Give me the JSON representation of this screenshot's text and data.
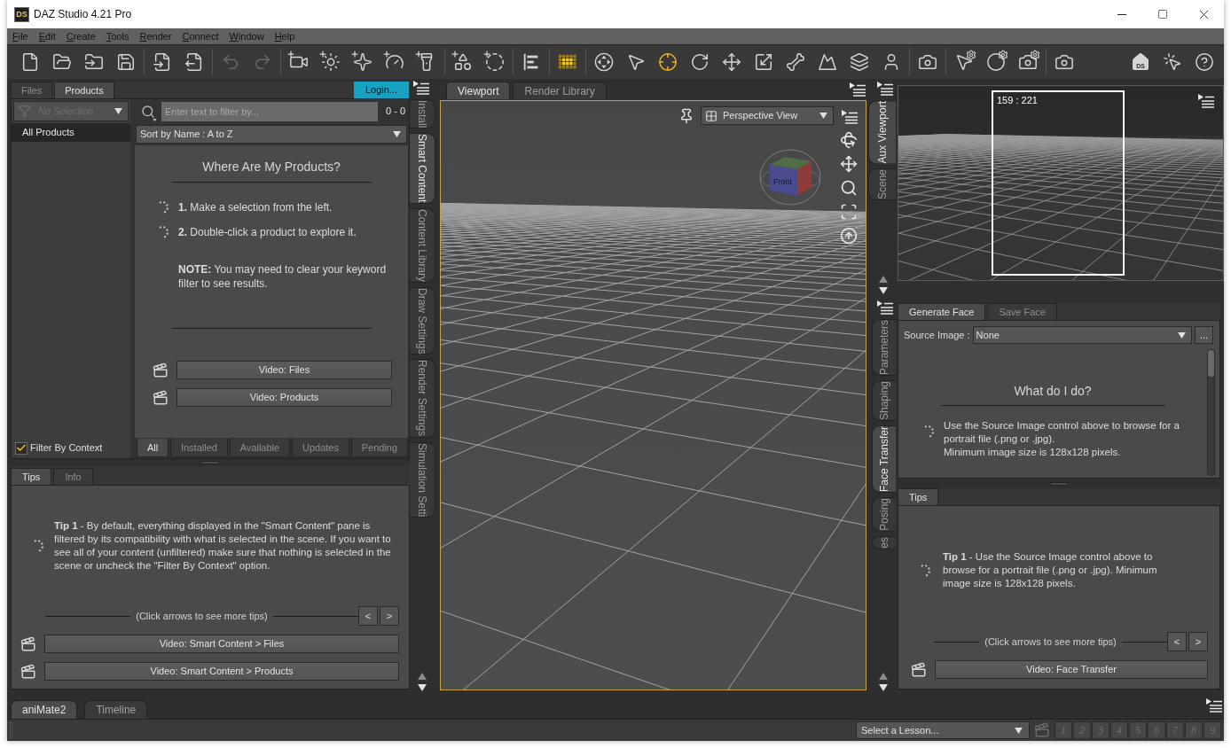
{
  "window": {
    "logo": "DS",
    "title": "DAZ Studio 4.21 Pro"
  },
  "menu": [
    "File",
    "Edit",
    "Create",
    "Tools",
    "Render",
    "Connect",
    "Window",
    "Help"
  ],
  "toolbar": {
    "groups": [
      {
        "items": [
          {
            "kind": "new",
            "disabled": false
          },
          {
            "kind": "open",
            "disabled": false
          },
          {
            "kind": "merge",
            "disabled": false
          },
          {
            "kind": "save",
            "disabled": false
          }
        ]
      },
      {
        "items": [
          {
            "kind": "import",
            "disabled": false
          },
          {
            "kind": "export",
            "disabled": false
          }
        ]
      },
      {
        "items": [
          {
            "kind": "undo",
            "disabled": true
          },
          {
            "kind": "redo",
            "disabled": true
          }
        ]
      },
      {
        "items": [
          {
            "kind": "camera",
            "disabled": false
          },
          {
            "kind": "distant_light",
            "disabled": false
          },
          {
            "kind": "point_light",
            "disabled": false
          },
          {
            "kind": "dial",
            "disabled": false
          },
          {
            "kind": "spotlight",
            "disabled": false
          }
        ]
      },
      {
        "items": [
          {
            "kind": "primitive",
            "disabled": false
          },
          {
            "kind": "null",
            "disabled": false
          }
        ]
      },
      {
        "items": [
          {
            "kind": "align",
            "disabled": false
          }
        ]
      },
      {
        "items": [
          {
            "kind": "pixel_grid",
            "disabled": false
          }
        ]
      },
      {
        "items": [
          {
            "kind": "navigate",
            "selected": false
          },
          {
            "kind": "select",
            "selected": false
          },
          {
            "kind": "universal",
            "selected": true
          },
          {
            "kind": "rotate",
            "selected": false
          },
          {
            "kind": "translate",
            "selected": false
          },
          {
            "kind": "scale",
            "selected": false
          },
          {
            "kind": "joint",
            "selected": false
          },
          {
            "kind": "geometry",
            "selected": false
          },
          {
            "kind": "surface",
            "selected": false
          },
          {
            "kind": "weight",
            "selected": false
          }
        ]
      },
      {
        "items": [
          {
            "kind": "camera_pointer",
            "disabled": false
          }
        ]
      },
      {
        "items": [
          {
            "kind": "pointer_gear",
            "disabled": false
          },
          {
            "kind": "sphere_gear",
            "disabled": false
          },
          {
            "kind": "camera_gear",
            "disabled": false
          }
        ]
      },
      {
        "items": [
          {
            "kind": "snapshot",
            "disabled": false
          }
        ]
      }
    ],
    "right": [
      {
        "kind": "home",
        "label": "DS"
      },
      {
        "kind": "whats_this"
      },
      {
        "kind": "help"
      }
    ]
  },
  "content_pane": {
    "tabs": [
      {
        "label": "Files",
        "selected": false
      },
      {
        "label": "Products",
        "selected": true
      }
    ],
    "login_button": "Login...",
    "category_dropdown": {
      "value": "No Selection",
      "disabled": true
    },
    "categories": [
      {
        "label": "All Products",
        "selected": true
      }
    ],
    "filter_by_context": {
      "label": "Filter By Context",
      "checked": true
    },
    "search": {
      "placeholder": "Enter text to filter by...",
      "count": "0 - 0"
    },
    "sort_dropdown": "Sort by Name : A to Z",
    "help_title": "Where Are My Products?",
    "steps": [
      "**1.** Make a selection from the left.",
      "**2.** Double-click a product to explore it."
    ],
    "note": "**NOTE:** You may need to clear your keyword filter to see results.",
    "video_buttons": [
      "Video: Files",
      "Video: Products"
    ],
    "status_tabs": [
      {
        "label": "All",
        "selected": true
      },
      {
        "label": "Installed",
        "selected": false
      },
      {
        "label": "Available",
        "selected": false
      },
      {
        "label": "Updates",
        "selected": false
      },
      {
        "label": "Pending",
        "selected": false
      }
    ]
  },
  "left_side_tabs": [
    {
      "label": "Install",
      "selected": false
    },
    {
      "label": "Smart Content",
      "selected": true
    },
    {
      "label": "Content Library",
      "selected": false
    },
    {
      "label": "Draw Settings",
      "selected": false
    },
    {
      "label": "Render Settings",
      "selected": false
    },
    {
      "label": "Simulation Setti",
      "selected": false
    }
  ],
  "tips_pane": {
    "tabs": [
      {
        "label": "Tips",
        "selected": true
      },
      {
        "label": "Info",
        "selected": false
      }
    ],
    "tip": "**Tip 1** - By default, everything displayed in the \"Smart Content\" pane is filtered by its compatibility with what is selected in the scene. If you want to see all of your content (unfiltered) make sure that nothing is selected in the scene or uncheck the \"Filter By Context\" option.",
    "hint": "(Click arrows to see more tips)",
    "prev_button": "<",
    "next_button": ">",
    "video_buttons": [
      "Video: Smart Content > Files",
      "Video: Smart Content > Products"
    ]
  },
  "viewport_pane": {
    "tabs": [
      {
        "label": "Viewport",
        "selected": true
      },
      {
        "label": "Render Library",
        "selected": false
      }
    ],
    "camera_dropdown": "Perspective View",
    "cube_label": "Front"
  },
  "aux_side_tabs": [
    {
      "label": "Aux Viewport",
      "selected": true
    },
    {
      "label": "Scene",
      "selected": false
    }
  ],
  "aux_viewport": {
    "frame_size": "159 : 221"
  },
  "right_side_tabs": [
    {
      "label": "Parameters",
      "selected": false
    },
    {
      "label": "Shaping",
      "selected": false
    },
    {
      "label": "Face Transfer",
      "selected": true
    },
    {
      "label": "Posing",
      "selected": false
    },
    {
      "label": "es",
      "selected": false
    }
  ],
  "face_transfer": {
    "tabs": [
      {
        "label": "Generate Face",
        "selected": true
      },
      {
        "label": "Save Face",
        "selected": false
      }
    ],
    "source_label": "Source Image :",
    "source_value": "None",
    "browse_button": "...",
    "title": "What do I do?",
    "instructions": "Use the Source Image control above to browse for a portrait file (.png or .jpg).\nMinimum image size is 128x128 pixels."
  },
  "face_tips": {
    "tabs": [
      {
        "label": "Tips",
        "selected": true
      }
    ],
    "tip": "**Tip 1** - Use the Source Image control above to browse for a portrait file (.png or .jpg). Minimum image size is 128x128 pixels.",
    "hint": "(Click arrows to see more tips)",
    "prev_button": "<",
    "next_button": ">",
    "video_buttons": [
      "Video: Face Transfer"
    ]
  },
  "bottom_pane": {
    "tabs": [
      {
        "label": "aniMate2",
        "selected": true
      },
      {
        "label": "Timeline",
        "selected": false
      }
    ],
    "lesson_dropdown": "Select a Lesson...",
    "lessons": [
      {
        "label": "1",
        "disabled": true
      },
      {
        "label": "2",
        "disabled": true
      },
      {
        "label": "3",
        "disabled": true
      },
      {
        "label": "4",
        "disabled": true
      },
      {
        "label": "5",
        "disabled": true
      },
      {
        "label": "6",
        "disabled": true
      },
      {
        "label": "7",
        "disabled": true
      },
      {
        "label": "8",
        "disabled": true
      },
      {
        "label": "9",
        "disabled": true
      }
    ]
  }
}
